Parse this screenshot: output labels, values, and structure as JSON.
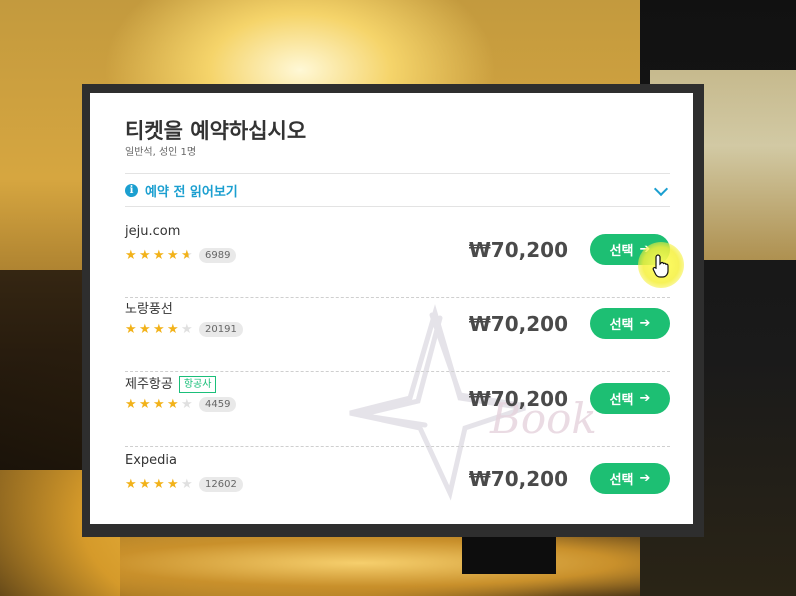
{
  "dialog": {
    "title": "티켓을 예약하십시오",
    "subtitle": "일반석, 성인 1명",
    "notice": "예약 전 읽어보기",
    "info_glyph": "i"
  },
  "vendors": [
    {
      "name": "jeju.com",
      "badge": "",
      "rating": 4.5,
      "reviews": "6989",
      "price": "₩70,200",
      "button": "선택"
    },
    {
      "name": "노랑풍선",
      "badge": "",
      "rating": 4,
      "reviews": "20191",
      "price": "₩70,200",
      "button": "선택"
    },
    {
      "name": "제주항공",
      "badge": "항공사",
      "rating": 4,
      "reviews": "4459",
      "price": "₩70,200",
      "button": "선택"
    },
    {
      "name": "Expedia",
      "badge": "",
      "rating": 4,
      "reviews": "12602",
      "price": "₩70,200",
      "button": "선택"
    }
  ],
  "watermark": {
    "text": "Book"
  },
  "icons": [
    "info-icon",
    "chevron-down-icon",
    "star-icon",
    "arrow-right-icon",
    "hand-cursor-icon"
  ],
  "colors": {
    "accent": "#1b9fd0",
    "button": "#1dbf73",
    "star": "#f2b21a"
  }
}
